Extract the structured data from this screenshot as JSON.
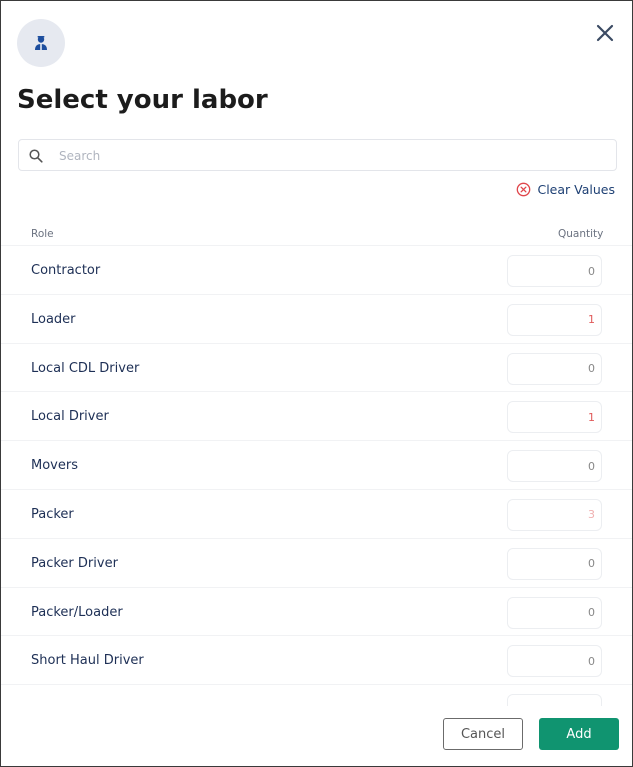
{
  "header": {
    "icon": "worker-icon",
    "title": "Select your labor"
  },
  "search": {
    "placeholder": "Search",
    "value": ""
  },
  "clear_values": {
    "label": "Clear Values",
    "icon": "circle-x-icon",
    "color": "#e0474c"
  },
  "table": {
    "columns": {
      "role": "Role",
      "quantity": "Quantity"
    },
    "rows": [
      {
        "role": "Contractor",
        "quantity": "0"
      },
      {
        "role": "Loader",
        "quantity": "1"
      },
      {
        "role": "Local CDL Driver",
        "quantity": "0"
      },
      {
        "role": "Local Driver",
        "quantity": "1"
      },
      {
        "role": "Movers",
        "quantity": "0"
      },
      {
        "role": "Packer",
        "quantity": "3"
      },
      {
        "role": "Packer Driver",
        "quantity": "0"
      },
      {
        "role": "Packer/Loader",
        "quantity": "0"
      },
      {
        "role": "Short Haul Driver",
        "quantity": "0"
      }
    ]
  },
  "footer": {
    "cancel_label": "Cancel",
    "add_label": "Add",
    "accent": "#109470"
  }
}
